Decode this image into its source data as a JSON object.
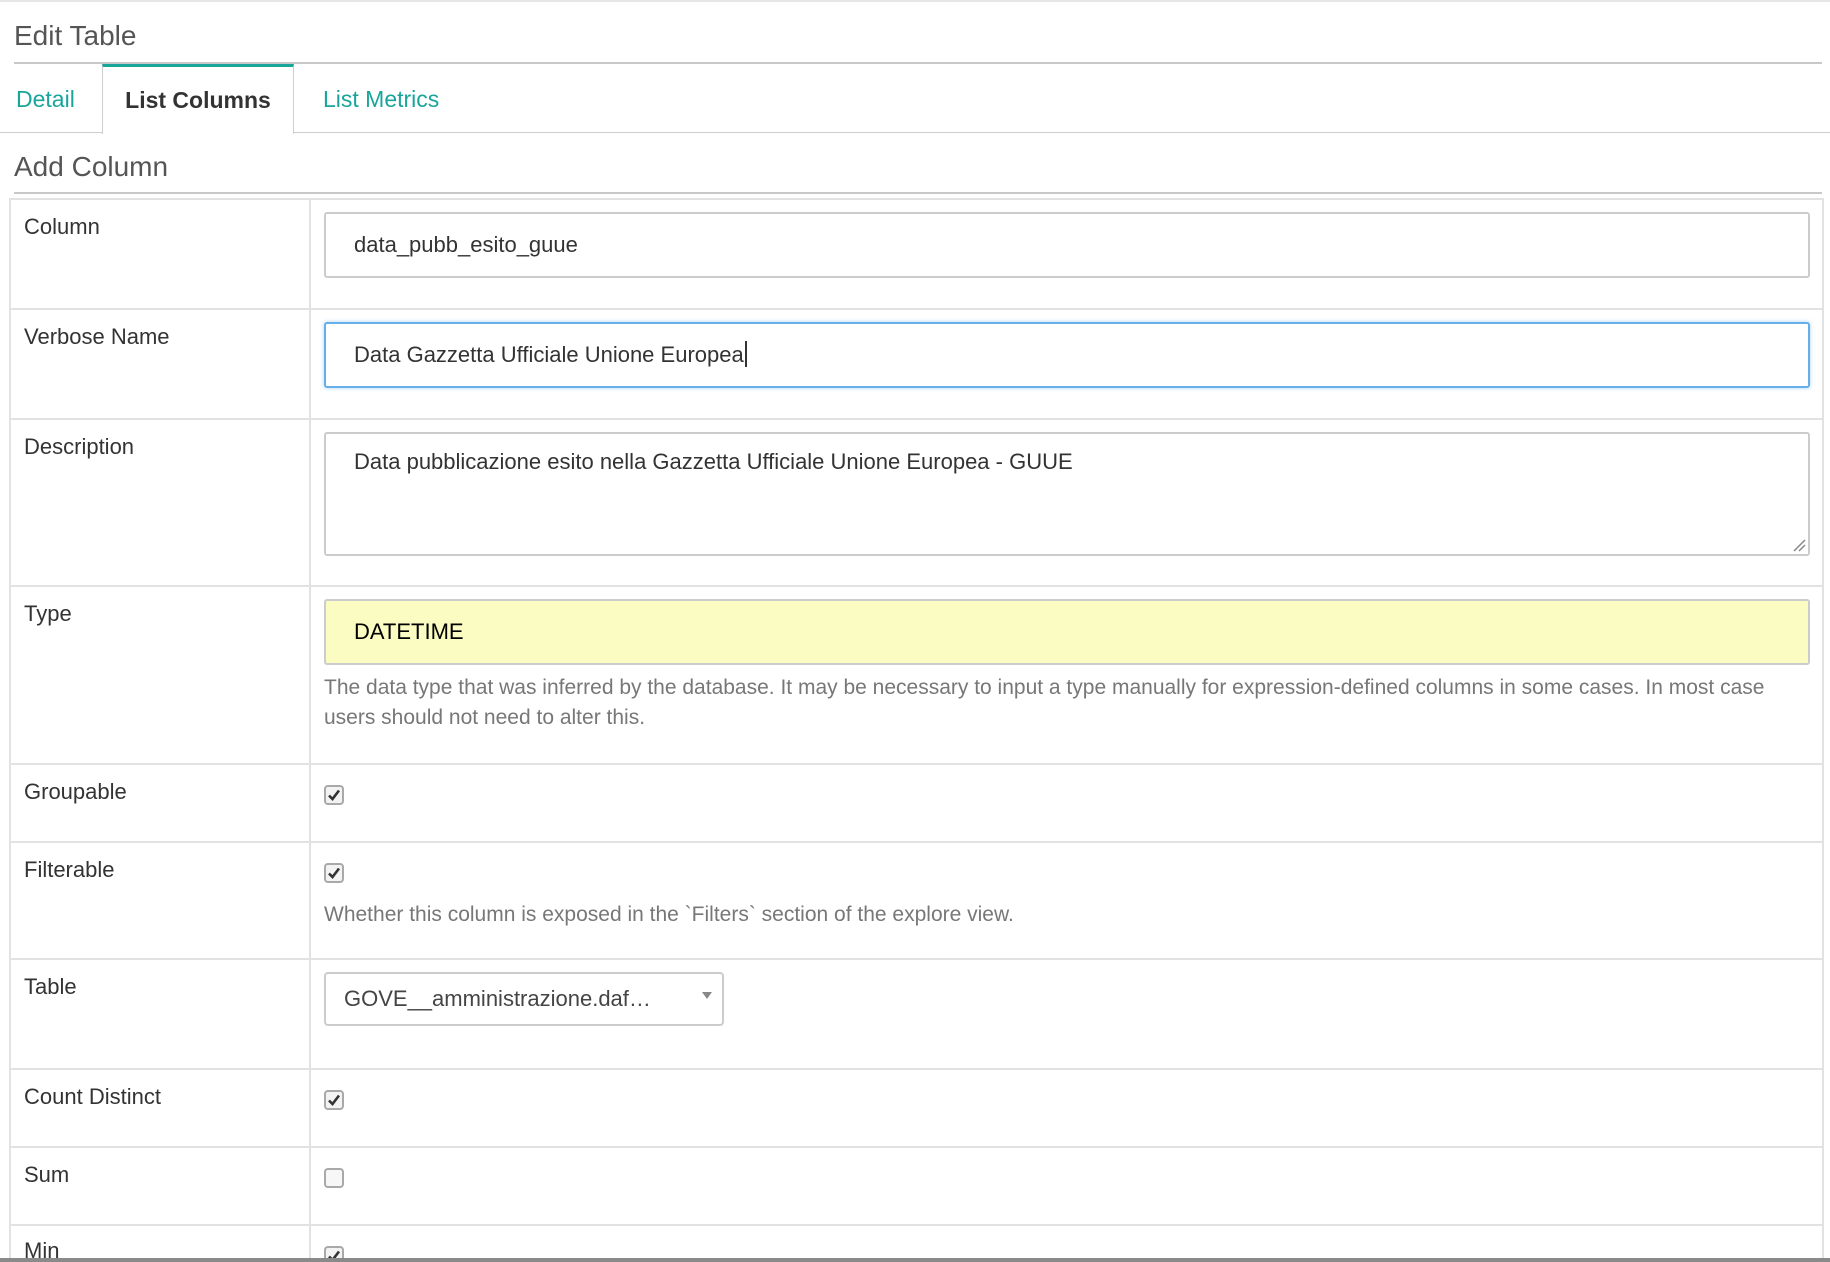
{
  "page": {
    "title": "Edit Table",
    "section_title": "Add Column"
  },
  "tabs": [
    {
      "label": "Detail",
      "active": false
    },
    {
      "label": "List Columns",
      "active": true
    },
    {
      "label": "List Metrics",
      "active": false
    }
  ],
  "form": {
    "column": {
      "label": "Column",
      "value": "data_pubb_esito_guue"
    },
    "verbose_name": {
      "label": "Verbose Name",
      "value": "Data Gazzetta Ufficiale Unione Europea"
    },
    "description": {
      "label": "Description",
      "value": "Data pubblicazione esito nella Gazzetta Ufficiale Unione Europea - GUUE"
    },
    "type": {
      "label": "Type",
      "value": "DATETIME",
      "help": "The data type that was inferred by the database. It may be necessary to input a type manually for expression-defined columns in some cases. In most case users should not need to alter this."
    },
    "groupable": {
      "label": "Groupable",
      "checked": true
    },
    "filterable": {
      "label": "Filterable",
      "checked": true,
      "help": "Whether this column is exposed in the `Filters` section of the explore view."
    },
    "table": {
      "label": "Table",
      "value": "GOVE__amministrazione.daf…"
    },
    "count_distinct": {
      "label": "Count Distinct",
      "checked": true
    },
    "sum": {
      "label": "Sum",
      "checked": false
    },
    "min": {
      "label": "Min",
      "checked": true
    }
  },
  "colors": {
    "accent": "#1aa59b",
    "type_bg": "#fafcc2",
    "focus_border": "#66afe9"
  }
}
